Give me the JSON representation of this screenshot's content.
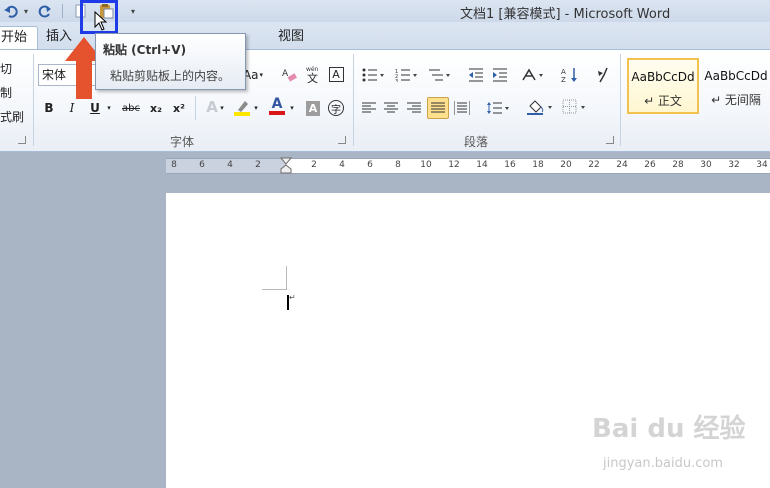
{
  "window": {
    "title": "文档1 [兼容模式] - Microsoft Word"
  },
  "tabs": [
    {
      "label": "开始"
    },
    {
      "label": "插入"
    },
    {
      "label": "视图"
    }
  ],
  "clipboard": {
    "cut": "切",
    "copy": "制",
    "format_painter": "式刷"
  },
  "font": {
    "name": "宋体",
    "label": "字体",
    "bold": "B",
    "italic": "I",
    "underline": "U",
    "strike": "abc",
    "subscript": "x₂",
    "superscript": "x²",
    "aa": "Aa",
    "char_border": "A",
    "char_shading": "A",
    "text_effect": "A",
    "font_color": "A",
    "enclose": "字",
    "phonetic": "wén"
  },
  "paragraph": {
    "label": "段落"
  },
  "styles": [
    {
      "sample": "AaBbCcDd",
      "name": "↵ 正文"
    },
    {
      "sample": "AaBbCcDd",
      "name": "↵ 无间隔"
    }
  ],
  "tooltip": {
    "title": "粘贴 (Ctrl+V)",
    "description": "粘贴剪贴板上的内容。"
  },
  "ruler": {
    "numbers": [
      "8",
      "6",
      "4",
      "2",
      "2",
      "4",
      "6",
      "8",
      "10",
      "12",
      "14",
      "16",
      "18",
      "20",
      "22",
      "24",
      "26",
      "28",
      "30",
      "32",
      "34"
    ]
  },
  "watermark": {
    "brand": "Bai du 经验",
    "url": "jingyan.baidu.com"
  },
  "colors": {
    "highlight_box": "#1e3be8",
    "arrow": "#e5532e",
    "font_color_bar": "#d9171a",
    "highlight_bar": "#ffe600"
  }
}
